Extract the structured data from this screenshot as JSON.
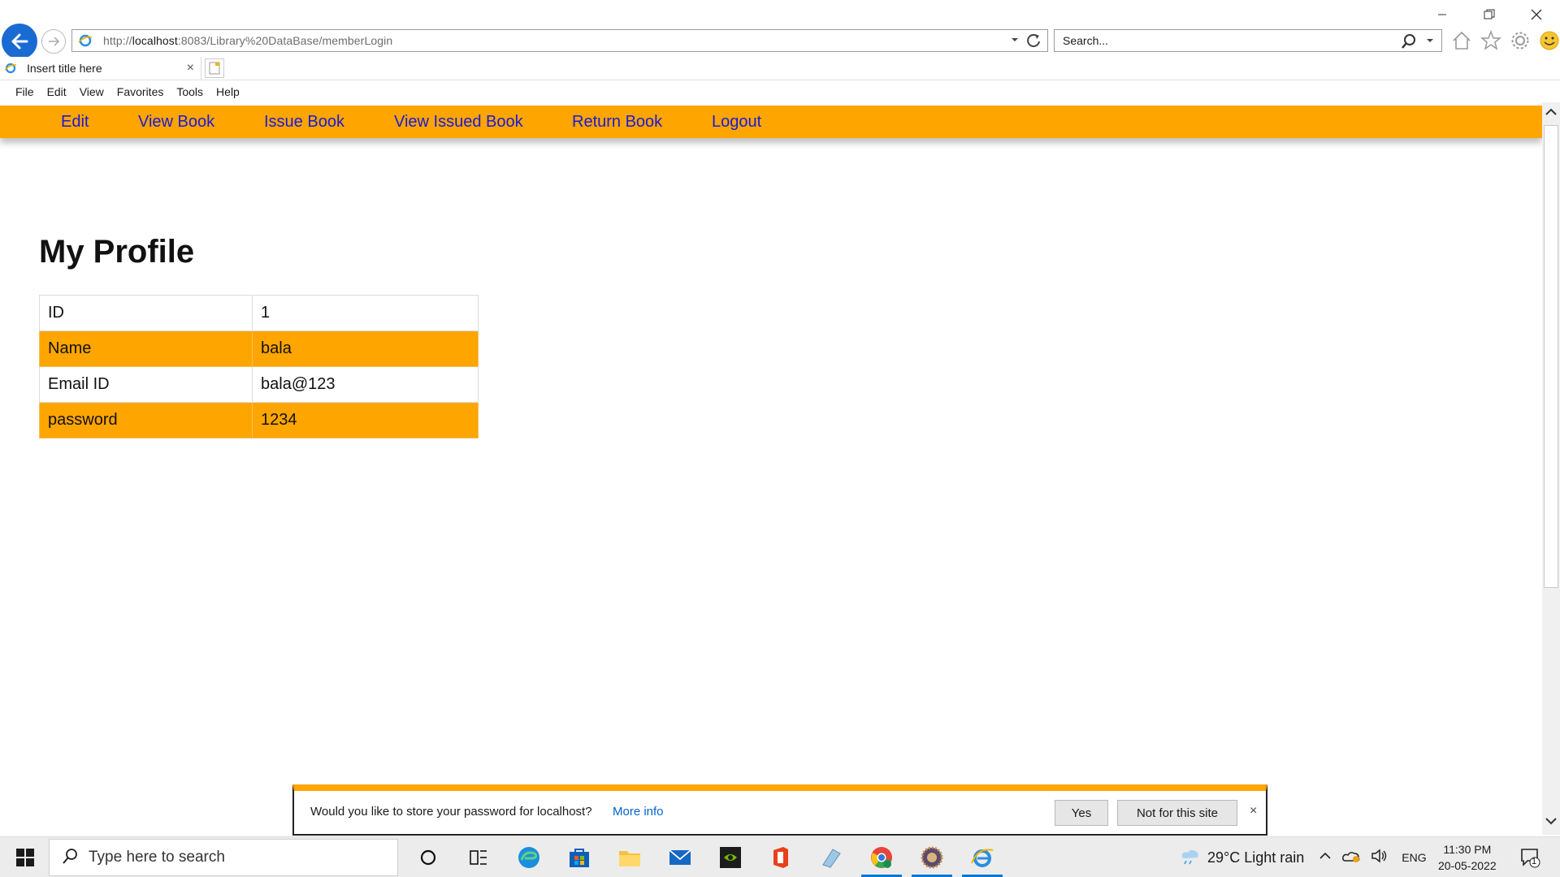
{
  "browser": {
    "url_prefix": "http://",
    "url_host": "localhost",
    "url_rest": ":8083/Library%20DataBase/memberLogin",
    "search_placeholder": "Search...",
    "tab_title": "Insert title here",
    "tab_close": "×",
    "menu": [
      "File",
      "Edit",
      "View",
      "Favorites",
      "Tools",
      "Help"
    ]
  },
  "site_nav": {
    "items": [
      "Edit",
      "View Book",
      "Issue Book",
      "View Issued Book",
      "Return Book",
      "Logout"
    ]
  },
  "profile": {
    "title": "My Profile",
    "rows": [
      {
        "label": "ID",
        "value": "1"
      },
      {
        "label": "Name",
        "value": "bala"
      },
      {
        "label": "Email ID",
        "value": "bala@123"
      },
      {
        "label": "password",
        "value": "1234"
      }
    ]
  },
  "password_prompt": {
    "message": "Would you like to store your password for localhost?",
    "more_info": "More info",
    "yes": "Yes",
    "no": "Not for this site",
    "close": "×"
  },
  "taskbar": {
    "search_placeholder": "Type here to search",
    "weather": "29°C  Light rain",
    "language": "ENG",
    "time": "11:30 PM",
    "date": "20-05-2022",
    "notification_count": "1"
  },
  "colors": {
    "accent": "#ffa500",
    "nav_link": "#1a1ad6",
    "ie_blue": "#1a6ad3"
  }
}
